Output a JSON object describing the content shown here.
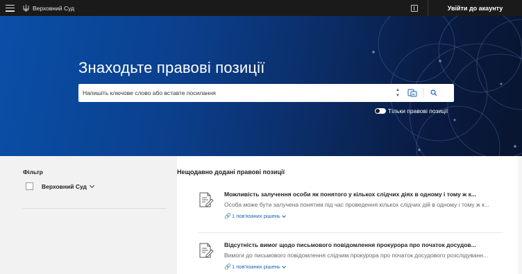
{
  "topbar": {
    "brand": "Верховний Суд",
    "login_label": "Увійти до акаунту"
  },
  "hero": {
    "title": "Знаходьте правові позиції",
    "search_placeholder": "Напишіть ключове слово або вставте посилання",
    "toggle_label": "Тільки правові позиції"
  },
  "filter": {
    "title": "Фільтр",
    "option_label": "Верховний Суд"
  },
  "results": {
    "title": "Нещодавно додані правові позиції",
    "items": [
      {
        "title": "Можливість залучення особи як понятого у кількох слідчих діях в одному і тому ж к...",
        "description": "Особа може бути залучена понятим під час проведення кількох слідчих дій в одному і тому ж к...",
        "link": "1 пов'язаних рішень"
      },
      {
        "title": "Відсутність вимог щодо письмового повідомлення прокурора про початок досудов...",
        "description": "Вимоги до письмового повідомлення слідчим прокурора про початок досудового розслідуванн...",
        "link": "1 пов'язаних рішень"
      }
    ]
  },
  "icons": {
    "menu": "hamburger-icon",
    "logo": "trident-icon",
    "book": "book-icon",
    "ai": "ai-search-icon",
    "search": "search-icon",
    "document": "document-edit-icon",
    "link": "link-icon"
  }
}
